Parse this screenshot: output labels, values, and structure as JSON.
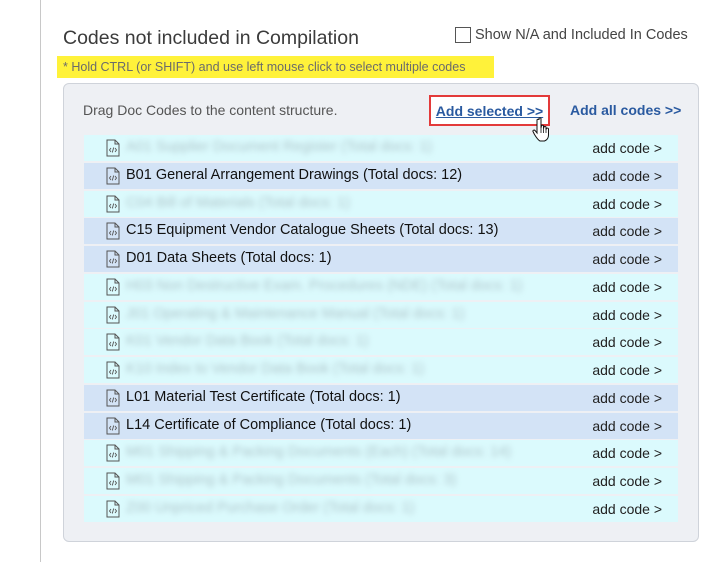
{
  "header": {
    "title": "Codes not included in Compilation",
    "show_na_label": "Show N/A and Included In Codes",
    "hint": "* Hold CTRL (or SHIFT) and use left mouse click to select multiple codes"
  },
  "panel": {
    "drag_text": "Drag Doc Codes to the content structure.",
    "add_selected_label": "Add selected >>",
    "add_all_label": "Add all codes >>"
  },
  "rows": [
    {
      "label": "A01 Supplier Document Register (Total docs: 1)",
      "action": "add code >",
      "selected": false,
      "blurred": true
    },
    {
      "label": "B01 General Arrangement Drawings (Total docs: 12)",
      "action": "add code >",
      "selected": true,
      "blurred": false
    },
    {
      "label": "C04 Bill of Materials (Total docs: 1)",
      "action": "add code >",
      "selected": false,
      "blurred": true
    },
    {
      "label": "C15 Equipment Vendor Catalogue Sheets (Total docs: 13)",
      "action": "add code >",
      "selected": true,
      "blurred": false
    },
    {
      "label": "D01 Data Sheets (Total docs: 1)",
      "action": "add code >",
      "selected": true,
      "blurred": false
    },
    {
      "label": "H03 Non Destructive Exam. Procedures (NDE) (Total docs: 1)",
      "action": "add code >",
      "selected": false,
      "blurred": true
    },
    {
      "label": "J01 Operating & Maintenance Manual (Total docs: 1)",
      "action": "add code >",
      "selected": false,
      "blurred": true
    },
    {
      "label": "K01 Vendor Data Book (Total docs: 1)",
      "action": "add code >",
      "selected": false,
      "blurred": true
    },
    {
      "label": "K10 Index to Vendor Data Book (Total docs: 1)",
      "action": "add code >",
      "selected": false,
      "blurred": true
    },
    {
      "label": "L01 Material Test Certificate (Total docs: 1)",
      "action": "add code >",
      "selected": true,
      "blurred": false
    },
    {
      "label": "L14 Certificate of Compliance (Total docs: 1)",
      "action": "add code >",
      "selected": true,
      "blurred": false
    },
    {
      "label": "M01 Shipping & Packing Documents (Each) (Total docs: 14)",
      "action": "add code >",
      "selected": false,
      "blurred": true
    },
    {
      "label": "M01 Shipping & Packing Documents (Total docs: 3)",
      "action": "add code >",
      "selected": false,
      "blurred": true
    },
    {
      "label": "Z00 Unpriced Purchase Order (Total docs: 1)",
      "action": "add code >",
      "selected": false,
      "blurred": true
    }
  ]
}
